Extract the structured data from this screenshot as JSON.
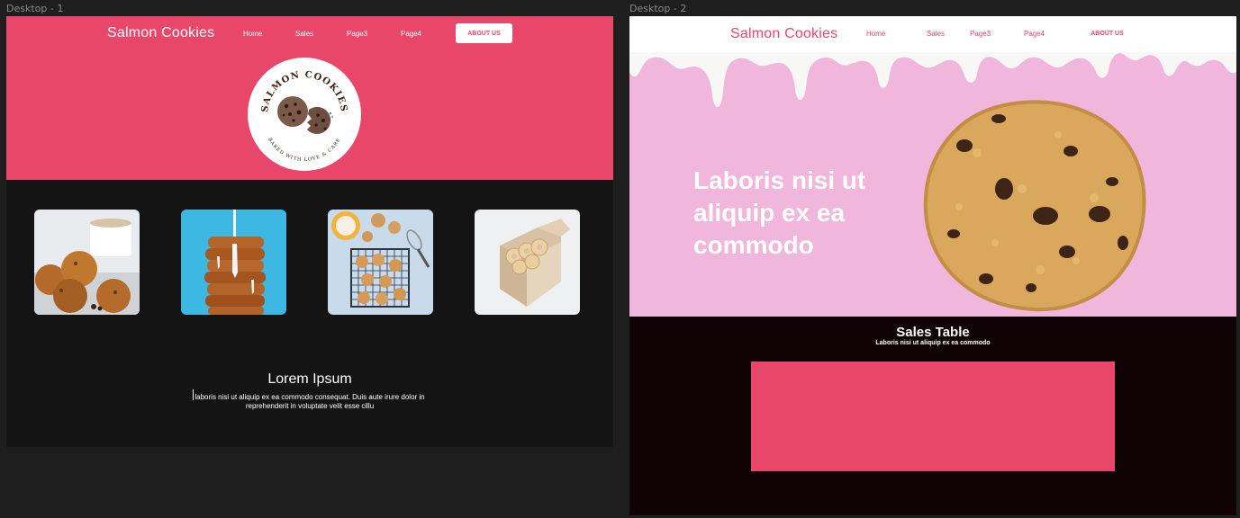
{
  "frames": {
    "desktop1_label": "Desktop - 1",
    "desktop2_label": "Desktop - 2"
  },
  "nav": {
    "brand": "Salmon Cookies",
    "links": [
      "Home",
      "Sales",
      "Page3",
      "Page4"
    ],
    "cta": "ABOUT US"
  },
  "logo": {
    "top_text": "SALMON COOKIES",
    "bottom_text": "BAKED WITH LOVE & CARE"
  },
  "gallery": {
    "tiles": [
      "cookies-with-coffee-photo",
      "stacked-cookies-with-glaze-photo",
      "cookies-on-cooling-rack-photo",
      "cookie-gift-box-photo"
    ]
  },
  "intro": {
    "title": "Lorem Ipsum",
    "body": "laboris nisi ut aliquip ex ea commodo consequat. Duis aute irure dolor in reprehenderit in voluptate velit esse cillu"
  },
  "hero2": {
    "heading": "Laboris nisi ut aliquip ex ea commodo"
  },
  "sales": {
    "title": "Sales Table",
    "subtitle": "Laboris nisi ut aliquip ex ea commodo"
  },
  "colors": {
    "accent": "#e8476a",
    "pink_bg": "#f0b6dc",
    "dark_bg": "#141414"
  }
}
